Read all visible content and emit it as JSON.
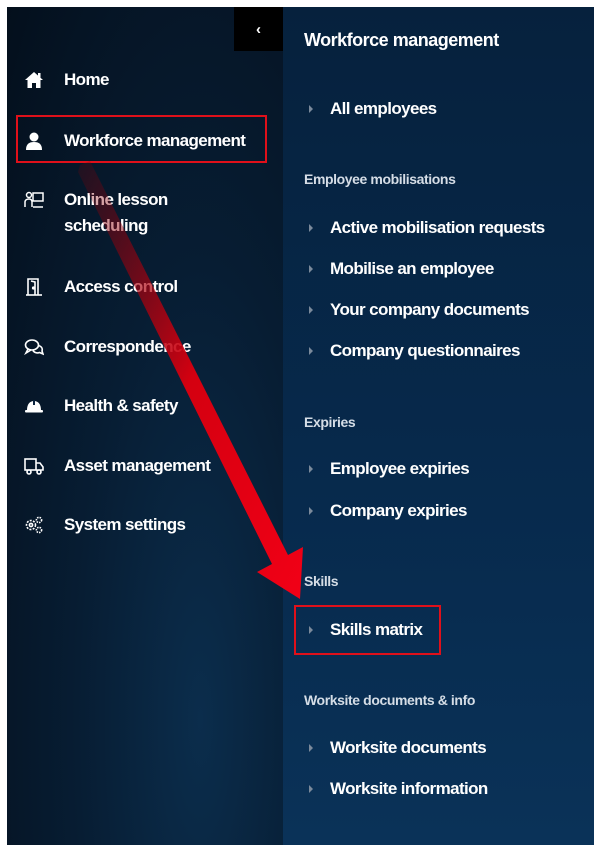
{
  "sidebar": {
    "collapse_glyph": "‹",
    "items": [
      {
        "label": "Home",
        "icon": "home-icon"
      },
      {
        "label": "Workforce management",
        "icon": "user-icon"
      },
      {
        "label": "Online lesson scheduling",
        "line1": "Online lesson",
        "line2": "scheduling",
        "icon": "teacher-board-icon"
      },
      {
        "label": "Access control",
        "icon": "door-icon"
      },
      {
        "label": "Correspondence",
        "icon": "chat-icon"
      },
      {
        "label": "Health & safety",
        "icon": "hard-hat-icon"
      },
      {
        "label": "Asset management",
        "icon": "truck-icon"
      },
      {
        "label": "System settings",
        "icon": "cogs-icon"
      }
    ]
  },
  "submenu": {
    "title": "Workforce management",
    "all_employees": "All employees",
    "sections": [
      {
        "title": "Employee mobilisations",
        "links": [
          "Active mobilisation requests",
          "Mobilise an employee",
          "Your company documents",
          "Company questionnaires"
        ]
      },
      {
        "title": "Expiries",
        "links": [
          "Employee expiries",
          "Company expiries"
        ]
      },
      {
        "title": "Skills",
        "links": [
          "Skills matrix"
        ]
      },
      {
        "title": "Worksite documents & info",
        "links": [
          "Worksite documents",
          "Worksite information"
        ]
      }
    ]
  },
  "annotation": {
    "color": "#e0101a"
  }
}
